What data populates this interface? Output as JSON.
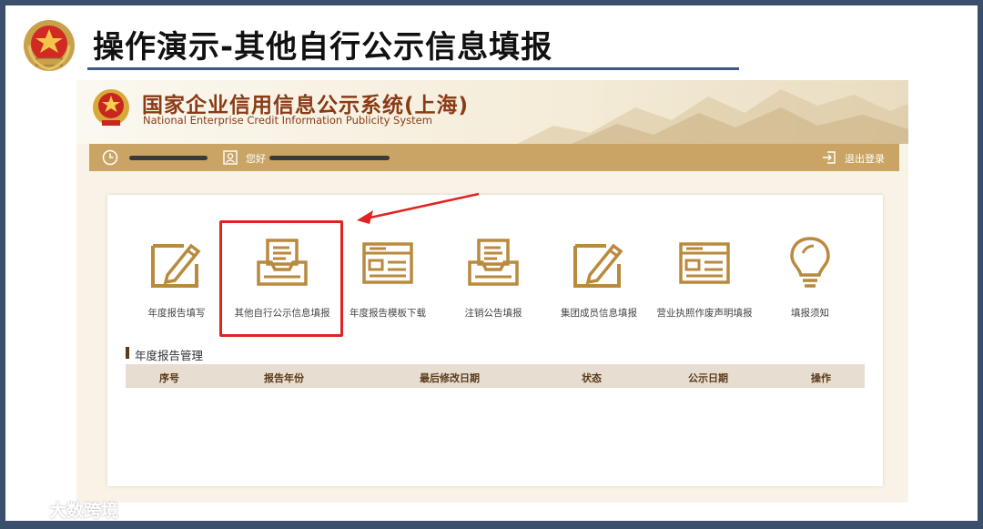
{
  "slide": {
    "title": "操作演示-其他自行公示信息填报"
  },
  "site": {
    "title_cn": "国家企业信用信息公示系统(上海)",
    "title_en": "National Enterprise Credit Information Publicity System"
  },
  "userbar": {
    "greeting": "您好",
    "logout_label": "退出登录"
  },
  "functions": [
    {
      "label": "年度报告填写",
      "icon": "pencil-frame-icon"
    },
    {
      "label": "其他自行公示信息填报",
      "icon": "inbox-document-icon"
    },
    {
      "label": "年度报告模板下载",
      "icon": "template-document-icon"
    },
    {
      "label": "注销公告填报",
      "icon": "inbox-document-icon"
    },
    {
      "label": "集团成员信息填报",
      "icon": "pencil-frame-icon"
    },
    {
      "label": "营业执照作废声明填报",
      "icon": "template-document-icon"
    },
    {
      "label": "填报须知",
      "icon": "lightbulb-icon"
    }
  ],
  "annual_report": {
    "section_title": "年度报告管理",
    "columns": [
      "序号",
      "报告年份",
      "最后修改日期",
      "状态",
      "公示日期",
      "操作"
    ]
  },
  "watermark": {
    "text": "大数跨境"
  },
  "colors": {
    "gold": "#c9a465",
    "icon_gold": "#b98a3e",
    "brown_text": "#8a3b16",
    "highlight_red": "#e0231f"
  }
}
